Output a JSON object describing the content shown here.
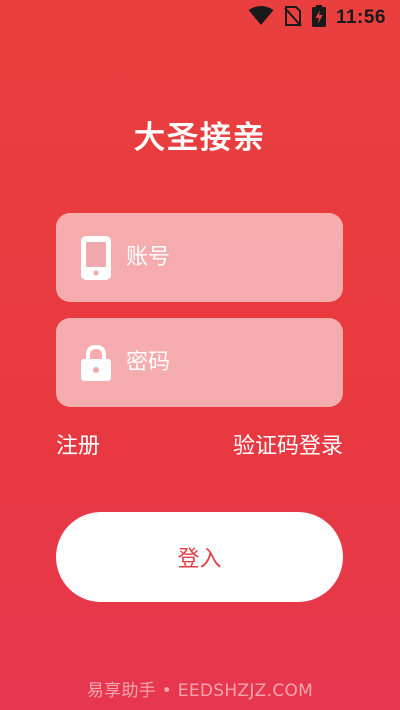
{
  "status_bar": {
    "time": "11:56",
    "icons": [
      "wifi-icon",
      "no-sim-icon",
      "battery-charging-icon"
    ]
  },
  "app": {
    "title": "大圣接亲"
  },
  "form": {
    "account_placeholder": "账号",
    "password_placeholder": "密码",
    "account_icon": "phone-icon",
    "password_icon": "lock-icon"
  },
  "links": {
    "register": "注册",
    "sms_login": "验证码登录"
  },
  "login_button_label": "登入",
  "watermark": "易享助手 • EEDSHZJZ.COM",
  "colors": {
    "background": "#e8393f",
    "button_text": "#e23f47",
    "field_bg": "rgba(255,255,255,0.58)"
  }
}
